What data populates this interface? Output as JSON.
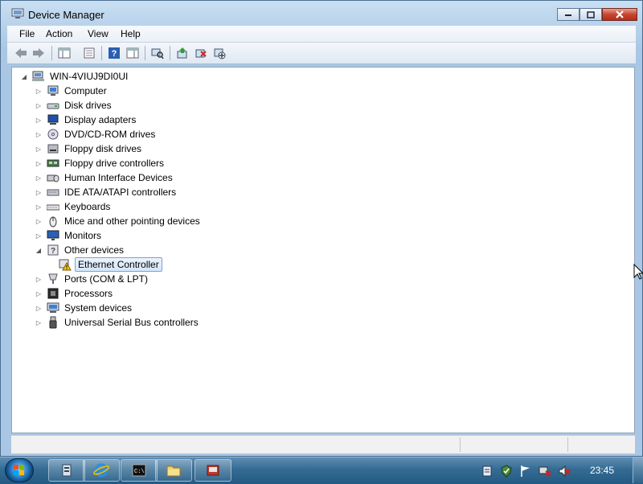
{
  "window": {
    "title": "Device Manager",
    "minimize_icon": "minimize-icon",
    "maximize_icon": "maximize-icon",
    "close_icon": "close-icon"
  },
  "menu": {
    "file": "File",
    "action": "Action",
    "view": "View",
    "help": "Help"
  },
  "toolbar": {
    "icons": [
      "back-icon",
      "forward-icon",
      "show-hide-console-tree-icon",
      "properties-icon",
      "help-icon",
      "show-action-pane-icon",
      "scan-hardware-icon",
      "update-driver-icon",
      "uninstall-icon",
      "disable-device-icon"
    ]
  },
  "tree": {
    "root": "WIN-4VIUJ9DI0UI",
    "categories": [
      {
        "label": "Computer",
        "icon": "computer-icon",
        "expanded": false
      },
      {
        "label": "Disk drives",
        "icon": "disk-drive-icon",
        "expanded": false
      },
      {
        "label": "Display adapters",
        "icon": "display-adapter-icon",
        "expanded": false
      },
      {
        "label": "DVD/CD-ROM drives",
        "icon": "dvd-drive-icon",
        "expanded": false
      },
      {
        "label": "Floppy disk drives",
        "icon": "floppy-disk-icon",
        "expanded": false
      },
      {
        "label": "Floppy drive controllers",
        "icon": "floppy-controller-icon",
        "expanded": false
      },
      {
        "label": "Human Interface Devices",
        "icon": "hid-icon",
        "expanded": false
      },
      {
        "label": "IDE ATA/ATAPI controllers",
        "icon": "ide-controller-icon",
        "expanded": false
      },
      {
        "label": "Keyboards",
        "icon": "keyboard-icon",
        "expanded": false
      },
      {
        "label": "Mice and other pointing devices",
        "icon": "mouse-icon",
        "expanded": false
      },
      {
        "label": "Monitors",
        "icon": "monitor-icon",
        "expanded": false
      },
      {
        "label": "Other devices",
        "icon": "unknown-device-icon",
        "expanded": true,
        "children": [
          {
            "label": "Ethernet Controller",
            "icon": "warning-device-icon",
            "selected": true
          }
        ]
      },
      {
        "label": "Ports (COM & LPT)",
        "icon": "port-icon",
        "expanded": false
      },
      {
        "label": "Processors",
        "icon": "processor-icon",
        "expanded": false
      },
      {
        "label": "System devices",
        "icon": "system-device-icon",
        "expanded": false
      },
      {
        "label": "Universal Serial Bus controllers",
        "icon": "usb-icon",
        "expanded": false
      }
    ]
  },
  "taskbar": {
    "start_icon": "windows-start-icon",
    "buttons": [
      "server-manager-icon",
      "internet-explorer-icon",
      "command-prompt-icon",
      "windows-explorer-icon",
      "device-manager-icon"
    ],
    "tray": [
      "action-center-icon",
      "security-shield-icon",
      "flag-icon",
      "network-icon",
      "volume-muted-icon"
    ],
    "clock": "23:45"
  },
  "colors": {
    "window_frame": "#a9c7e4",
    "taskbar": "#356c94",
    "selection": "#d5e6fb",
    "close_button": "#c74531"
  }
}
